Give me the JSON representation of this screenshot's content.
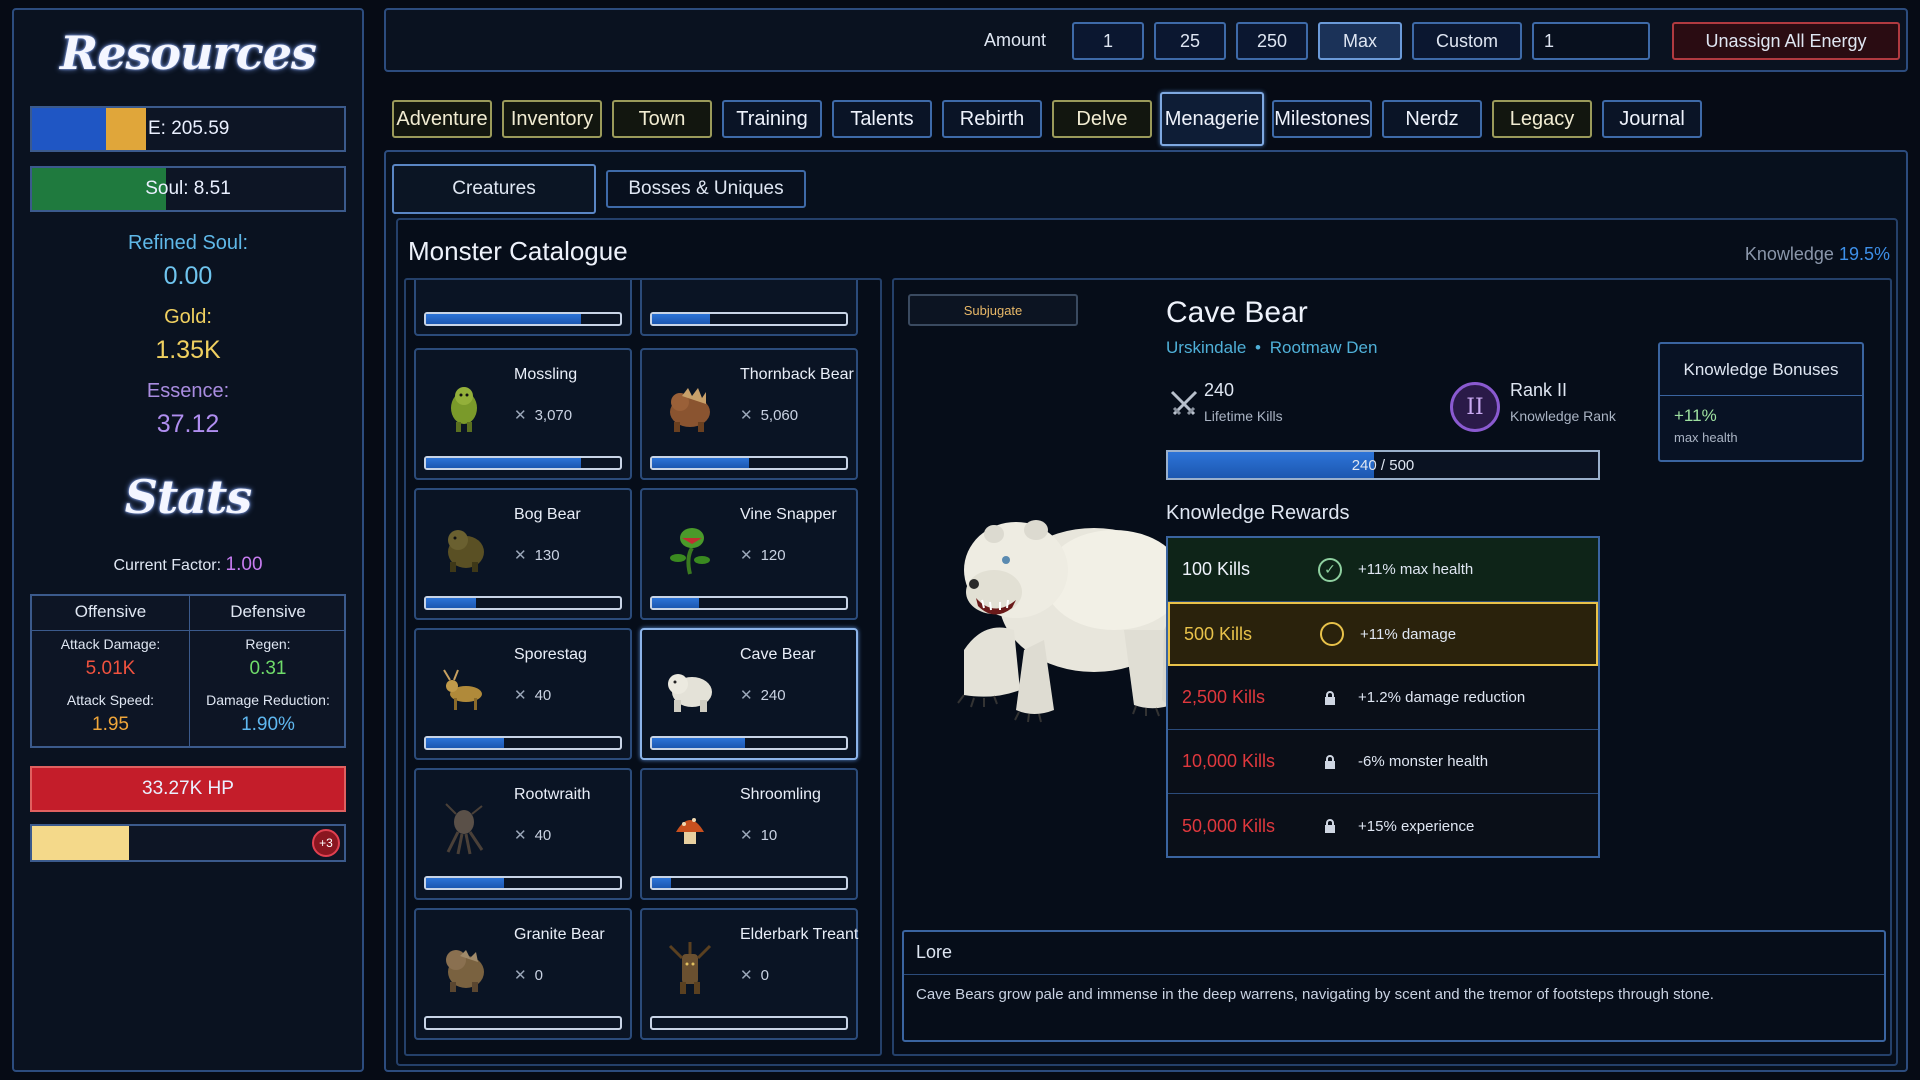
{
  "resources": {
    "title": "Resources",
    "energy_label": "E: 205.59",
    "soul_label": "Soul: 8.51",
    "refined_soul_label": "Refined Soul:",
    "refined_soul_value": "0.00",
    "gold_label": "Gold:",
    "gold_value": "1.35K",
    "essence_label": "Essence:",
    "essence_value": "37.12"
  },
  "stats": {
    "title": "Stats",
    "current_factor_label": "Current Factor:",
    "current_factor_value": "1.00",
    "offensive_header": "Offensive",
    "defensive_header": "Defensive",
    "attack_damage_label": "Attack Damage:",
    "attack_damage_value": "5.01K",
    "attack_speed_label": "Attack Speed:",
    "attack_speed_value": "1.95",
    "regen_label": "Regen:",
    "regen_value": "0.31",
    "damage_reduction_label": "Damage Reduction:",
    "damage_reduction_value": "1.90%",
    "hp_label": "33.27K HP",
    "xp_badge": "+3",
    "xp_fill": 0.31
  },
  "topbar": {
    "amount_label": "Amount",
    "amounts": [
      "1",
      "25",
      "250",
      "Max",
      "Custom"
    ],
    "selected_amount": "Max",
    "custom_value": "1",
    "unassign_label": "Unassign All Energy"
  },
  "tabs": [
    "Adventure",
    "Inventory",
    "Town",
    "Training",
    "Talents",
    "Rebirth",
    "Delve",
    "Menagerie",
    "Milestones",
    "Nerdz",
    "Legacy",
    "Journal"
  ],
  "selected_tab": "Menagerie",
  "subtabs": {
    "creatures": "Creatures",
    "bosses": "Bosses & Uniques"
  },
  "catalogue": {
    "title": "Monster Catalogue",
    "knowledge_label": "Knowledge",
    "knowledge_value": "19.5%"
  },
  "creatures": [
    {
      "name": "Mossling",
      "kills": "3,070",
      "progress": 0.8
    },
    {
      "name": "Thornback Bear",
      "kills": "5,060",
      "progress": 0.5
    },
    {
      "name": "Bog Bear",
      "kills": "130",
      "progress": 0.26
    },
    {
      "name": "Vine Snapper",
      "kills": "120",
      "progress": 0.24
    },
    {
      "name": "Sporestag",
      "kills": "40",
      "progress": 0.4
    },
    {
      "name": "Cave Bear",
      "kills": "240",
      "progress": 0.48
    },
    {
      "name": "Rootwraith",
      "kills": "40",
      "progress": 0.4
    },
    {
      "name": "Shroomling",
      "kills": "10",
      "progress": 0.1
    },
    {
      "name": "Granite Bear",
      "kills": "0",
      "progress": 0
    },
    {
      "name": "Elderbark Treant",
      "kills": "0",
      "progress": 0
    }
  ],
  "partial_progress": [
    0.8,
    0.3
  ],
  "detail": {
    "subjugate_label": "Subjugate",
    "name": "Cave Bear",
    "region": "Urskindale",
    "location": "Rootmaw Den",
    "kills_value": "240",
    "kills_label": "Lifetime Kills",
    "rank_glyph": "II",
    "rank_value": "Rank II",
    "rank_label": "Knowledge Rank",
    "progress_text": "240 / 500",
    "progress": 0.48,
    "rewards_title": "Knowledge Rewards",
    "rewards": [
      {
        "kills": "100 Kills",
        "desc": "+11% max health",
        "state": "done"
      },
      {
        "kills": "500 Kills",
        "desc": "+11% damage",
        "state": "current"
      },
      {
        "kills": "2,500 Kills",
        "desc": "+1.2% damage reduction",
        "state": "locked"
      },
      {
        "kills": "10,000 Kills",
        "desc": "-6% monster health",
        "state": "locked"
      },
      {
        "kills": "50,000 Kills",
        "desc": "+15% experience",
        "state": "locked"
      }
    ],
    "bonuses_title": "Knowledge Bonuses",
    "bonus_value": "+11%",
    "bonus_label": "max health",
    "lore_title": "Lore",
    "lore_text": "Cave Bears grow pale and immense in the deep warrens, navigating by scent and the tremor of footsteps through stone."
  },
  "colors": {
    "accent": "#3e6aa8",
    "energy_blue": "#1f56c4",
    "energy_gold": "#e0a63a",
    "soul_green": "#1f7a3e",
    "hp_red": "#c41d2a",
    "locked_red": "#e0383d",
    "current_gold": "#e8c24a"
  }
}
